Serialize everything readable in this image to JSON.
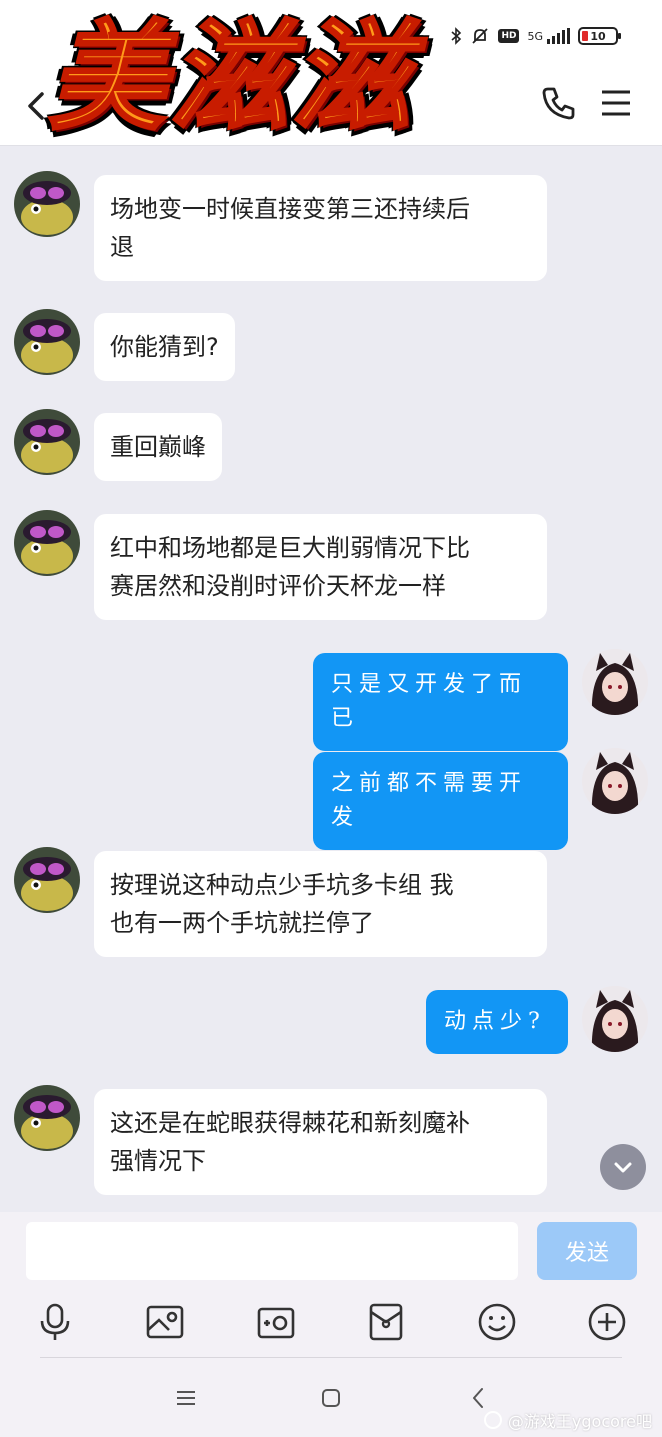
{
  "status_bar": {
    "network": "5G",
    "hd": "HD",
    "battery": "10"
  },
  "banner": {
    "text": "美滋滋"
  },
  "messages": [
    {
      "side": "in",
      "text_lines": [
        "场地变一时候直接变第三还持续后",
        "退"
      ]
    },
    {
      "side": "in",
      "text_lines": [
        "你能猜到?"
      ]
    },
    {
      "side": "in",
      "text_lines": [
        "重回巅峰"
      ]
    },
    {
      "side": "in",
      "text_lines": [
        "红中和场地都是巨大削弱情况下比",
        "赛居然和没削时评价天杯龙一样"
      ]
    },
    {
      "side": "out",
      "text_lines": [
        "只是又开发了而已"
      ]
    },
    {
      "side": "out",
      "text_lines": [
        "之前都不需要开发"
      ]
    },
    {
      "side": "in",
      "text_lines": [
        "按理说这种动点少手坑多卡组 我",
        "也有一两个手坑就拦停了"
      ]
    },
    {
      "side": "out",
      "text_lines": [
        "动点少?"
      ]
    },
    {
      "side": "in",
      "text_lines": [
        "这还是在蛇眼获得棘花和新刻魔补",
        "强情况下"
      ]
    }
  ],
  "input": {
    "placeholder": "",
    "send_label": "发送"
  },
  "toolbar": {
    "icons": [
      "microphone-icon",
      "image-icon",
      "camera-icon",
      "red-packet-icon",
      "emoji-icon",
      "plus-icon"
    ]
  },
  "watermark": {
    "text": "@游戏王ygocore吧"
  },
  "colors": {
    "accent": "#1296f5",
    "send_disabled": "#9cc9f8",
    "chat_bg": "#ebebf2"
  }
}
